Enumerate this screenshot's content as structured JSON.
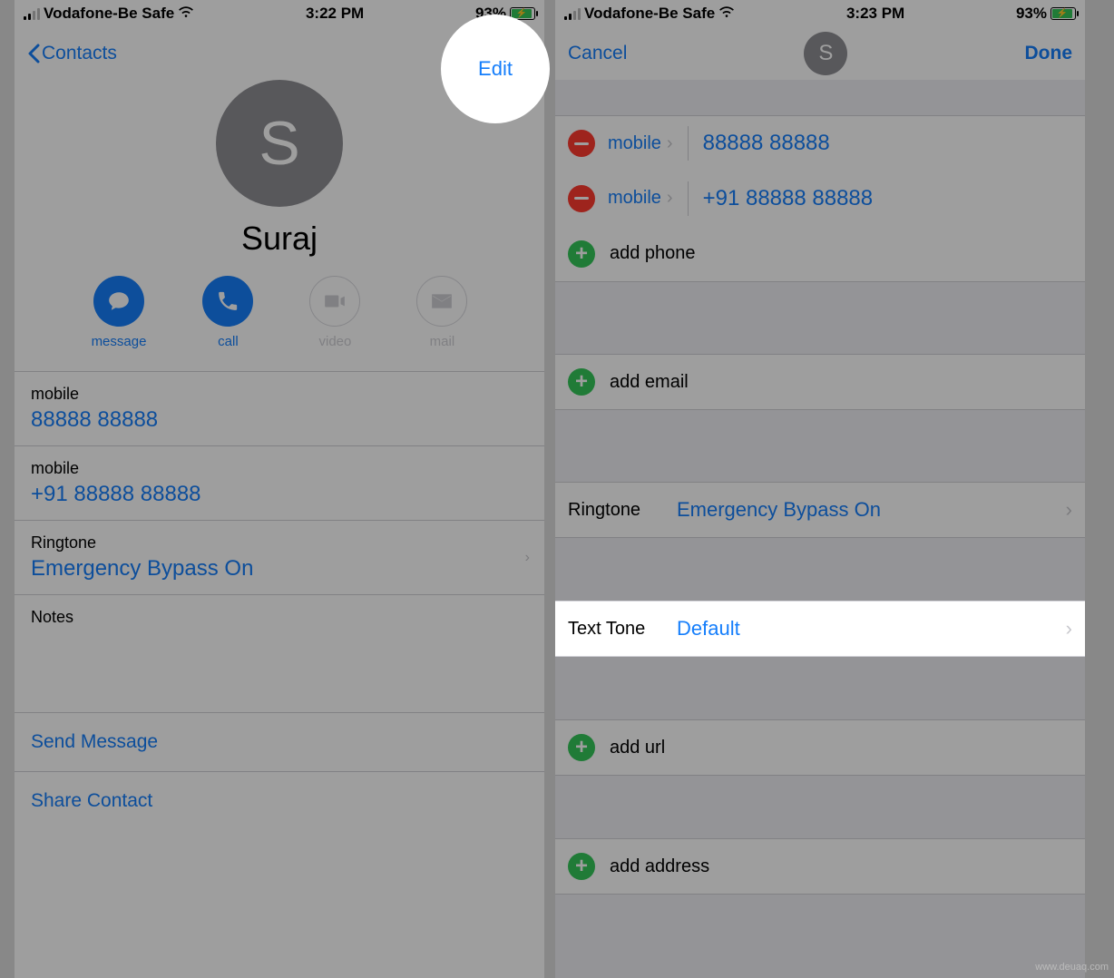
{
  "watermark": "www.deuaq.com",
  "left": {
    "status": {
      "carrier": "Vodafone-Be Safe",
      "time": "3:22 PM",
      "battery": "93%"
    },
    "nav": {
      "back": "Contacts",
      "edit": "Edit"
    },
    "hero": {
      "initial": "S",
      "name": "Suraj"
    },
    "actions": {
      "message": "message",
      "call": "call",
      "video": "video",
      "mail": "mail"
    },
    "phones": [
      {
        "label": "mobile",
        "value": "88888 88888"
      },
      {
        "label": "mobile",
        "value": "+91 88888 88888"
      }
    ],
    "ringtone": {
      "label": "Ringtone",
      "value": "Emergency Bypass On"
    },
    "notes_label": "Notes",
    "send_message": "Send Message",
    "share_contact": "Share Contact"
  },
  "right": {
    "status": {
      "carrier": "Vodafone-Be Safe",
      "time": "3:23 PM",
      "battery": "93%"
    },
    "nav": {
      "cancel": "Cancel",
      "initial": "S",
      "done": "Done"
    },
    "phones": [
      {
        "type": "mobile",
        "value": "88888 88888"
      },
      {
        "type": "mobile",
        "value": "+91 88888 88888"
      }
    ],
    "add_phone": "add phone",
    "add_email": "add email",
    "ringtone": {
      "label": "Ringtone",
      "value": "Emergency Bypass On"
    },
    "texttone": {
      "label": "Text Tone",
      "value": "Default"
    },
    "add_url": "add url",
    "add_address": "add address"
  }
}
